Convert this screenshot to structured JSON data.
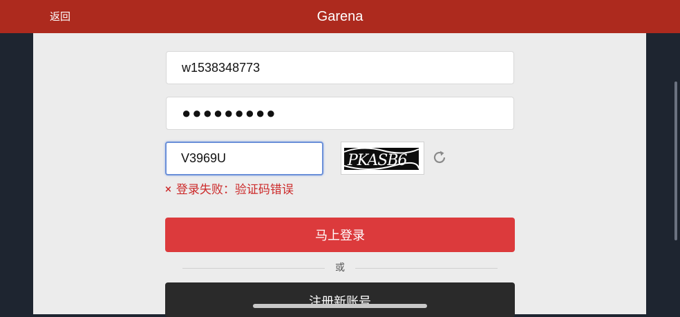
{
  "header": {
    "back_label": "返回",
    "title": "Garena",
    "background": "#ad2a1e"
  },
  "form": {
    "username_value": "w1538348773",
    "password_value": "●●●●●●●●●",
    "captcha_value": "V3969U",
    "captcha_image_text": "PKASB6",
    "error_message": "登录失败：验证码错误",
    "error_icon": "×",
    "login_label": "马上登录",
    "or_label": "或",
    "register_label": "注册新账号"
  },
  "icons": {
    "refresh": "refresh-icon",
    "error": "error-x-icon"
  },
  "colors": {
    "login_button": "#dc3a3c",
    "register_button": "#2a2a2a",
    "error_text": "#cc2a2a"
  }
}
